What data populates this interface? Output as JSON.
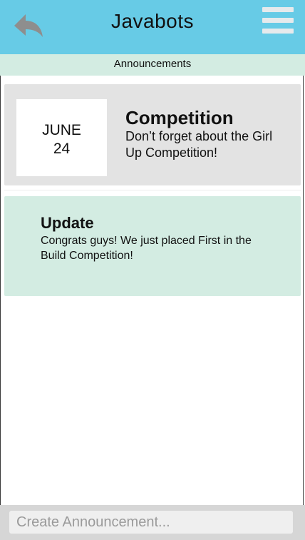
{
  "header": {
    "title": "Javabots",
    "back_icon": "back-arrow-icon",
    "menu_icon": "hamburger-menu-icon",
    "bg_color": "#67cbe6"
  },
  "subheader": {
    "label": "Announcements",
    "bg_color": "#d3ece2"
  },
  "announcements": [
    {
      "date_month": "JUNE",
      "date_day": "24",
      "title": "Competition",
      "body": "Don’t forget about the Girl Up Competition!"
    },
    {
      "title": "Update",
      "body": "Congrats guys! We just placed First in the Build Competition!"
    }
  ],
  "footer": {
    "placeholder": "Create Announcement..."
  }
}
